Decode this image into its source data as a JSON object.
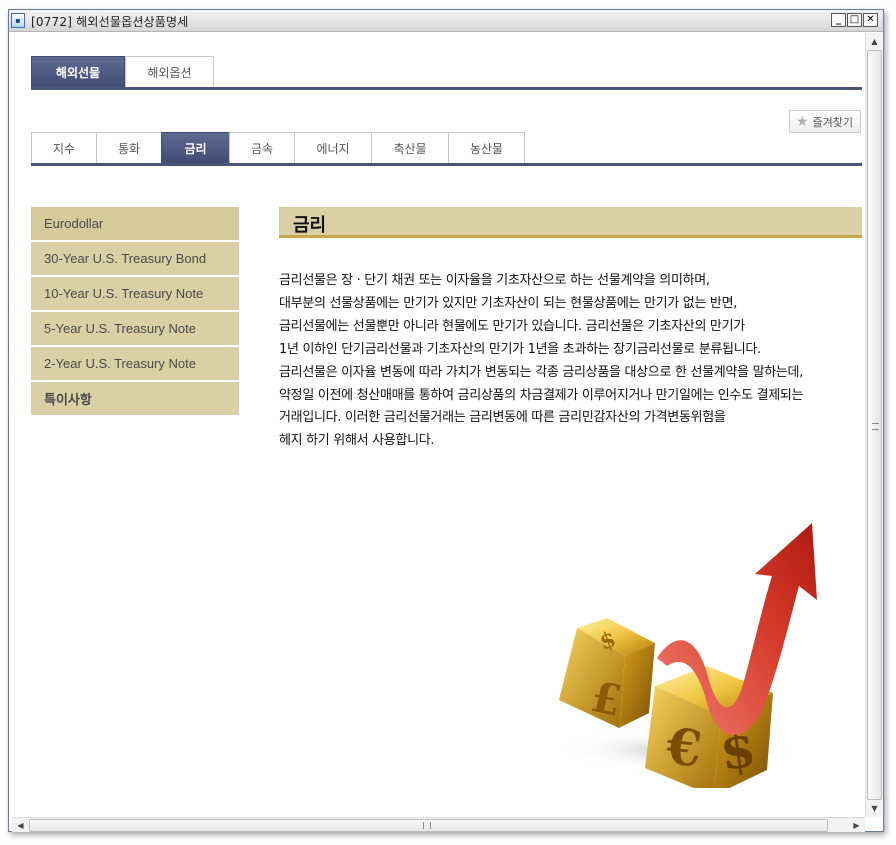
{
  "window": {
    "title": "[0772] 해외선물옵션상품명세",
    "app_icon": "window-app-icon",
    "controls": [
      "minimize-icon",
      "maximize-icon",
      "close-icon"
    ]
  },
  "top_tabs": [
    {
      "label": "해외선물",
      "active": true
    },
    {
      "label": "해외옵션",
      "active": false
    }
  ],
  "favorite_button": {
    "label": "즐겨찾기",
    "icon": "star-icon"
  },
  "sub_tabs": [
    {
      "label": "지수",
      "active": false
    },
    {
      "label": "통화",
      "active": false
    },
    {
      "label": "금리",
      "active": true
    },
    {
      "label": "금속",
      "active": false
    },
    {
      "label": "에너지",
      "active": false
    },
    {
      "label": "축산물",
      "active": false
    },
    {
      "label": "농산물",
      "active": false
    }
  ],
  "left_menu": [
    {
      "label": "Eurodollar"
    },
    {
      "label": "30-Year U.S. Treasury Bond"
    },
    {
      "label": "10-Year U.S. Treasury Note"
    },
    {
      "label": "5-Year U.S. Treasury Note"
    },
    {
      "label": "2-Year U.S. Treasury Note"
    },
    {
      "label": "특이사항"
    }
  ],
  "content": {
    "title": "금리",
    "lines": [
      "금리선물은 장 · 단기 채권 또는 이자율을 기초자산으로 하는 선물계약을 의미하며,",
      "대부분의 선물상품에는 만기가 있지만 기초자산이 되는 현물상품에는 만기가 없는 반면,",
      "금리선물에는 선물뿐만 아니라 현물에도 만기가 있습니다. 금리선물은 기초자산의 만기가",
      "1년 이하인 단기금리선물과 기초자산의 만기가 1년을 초과하는 장기금리선물로 분류됩니다.",
      "금리선물은 이자율 변동에 따라 가치가 변동되는 각종 금리상품을 대상으로 한 선물계약을 말하는데,",
      "약정일 이전에 청산매매를 통하여 금리상품의 차금결제가 이루어지거나 만기일에는 인수도 결제되는",
      "거래입니다. 이러한 금리선물거래는 금리변동에 따른 금리민감자산의 가격변동위험을",
      "헤지 하기 위해서 사용합니다."
    ],
    "illustration": "currency-dice-rising-arrow-image"
  },
  "colors": {
    "active_tab": "#4a5478",
    "menu_bg": "#dbcfa6",
    "title_underline": "#c9a649",
    "arrow": "#d63a2a",
    "dice_gold": "#e0b020"
  }
}
